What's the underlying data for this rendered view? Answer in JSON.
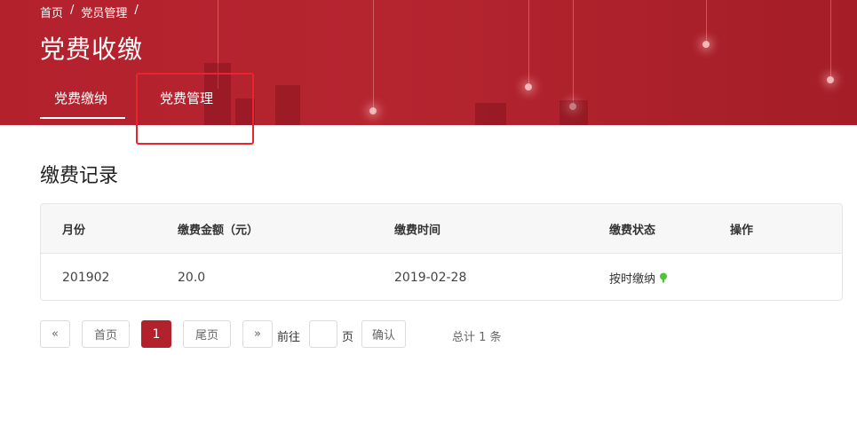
{
  "breadcrumb": {
    "home": "首页",
    "sep1": "/",
    "members": "党员管理",
    "sep2": "/"
  },
  "page_title": "党费收缴",
  "tabs": [
    {
      "label": "党费缴纳",
      "active": true
    },
    {
      "label": "党费管理",
      "active": false
    }
  ],
  "section_title": "缴费记录",
  "table": {
    "headers": [
      "月份",
      "缴费金额（元）",
      "缴费时间",
      "缴费状态",
      "操作"
    ],
    "rows": [
      {
        "month": "201902",
        "amount": "20.0",
        "time": "2019-02-28",
        "status": "按时缴纳",
        "action": ""
      }
    ]
  },
  "pagination": {
    "prev": "«",
    "first": "首页",
    "current": "1",
    "last": "尾页",
    "next": "»",
    "goto_label": "前往",
    "page_unit": "页",
    "confirm": "确认",
    "total": "总计 1 条"
  },
  "colors": {
    "brand_red": "#b3212d",
    "status_green": "#4fc23a",
    "highlight_red": "#e8242c"
  },
  "icons": {
    "status": "green-pin-icon"
  }
}
